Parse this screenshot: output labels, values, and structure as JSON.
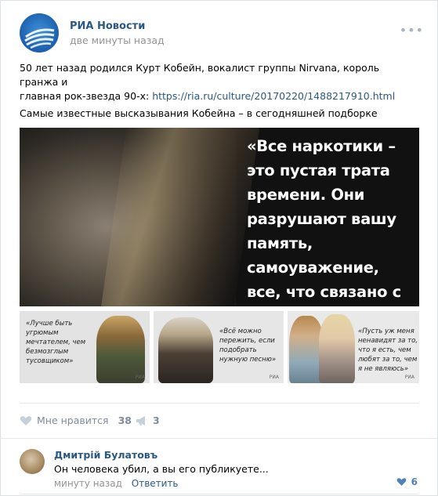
{
  "post": {
    "author": "РИА Новости",
    "time": "две минуты назад",
    "more_label": "•••",
    "text_line1": "50 лет назад родился Курт Кобейн, вокалист группы Nirvana, король гранжа и",
    "text_line2_prefix": "главная рок-звезда 90-х: ",
    "link": "https://ria.ru/culture/20170220/1488217910.html",
    "text_line3": "Самые известные высказывания Кобейна – в сегодняшней подборке",
    "main_quote": "«Все наркотики – это пустая трата времени. Они разрушают вашу память, самоуважение, все, что связано с самолюбием»",
    "thumbs": [
      {
        "quote": "«Лучше быть угрюмым мечтателем, чем безмозглым тусовщиком»",
        "logo": "РИА"
      },
      {
        "quote": "«Всё можно пережить, если подобрать нужную песню»",
        "logo": "РИА"
      },
      {
        "quote": "«Пусть уж меня ненавидят за то, что я есть, чем любят за то, чем я не являюсь»",
        "logo": "РИА"
      }
    ]
  },
  "actions": {
    "like_label": "Мне нравится",
    "like_count": "38",
    "share_count": "3"
  },
  "comment": {
    "author": "Дмитрій Булатовъ",
    "text": "Он человека убил, а вы его публикуете...",
    "time": "минуту назад",
    "reply_label": "Ответить",
    "likes": "6"
  },
  "colors": {
    "link": "#2a5885",
    "muted": "#939393",
    "action": "#828a99",
    "accent": "#5181b8"
  }
}
